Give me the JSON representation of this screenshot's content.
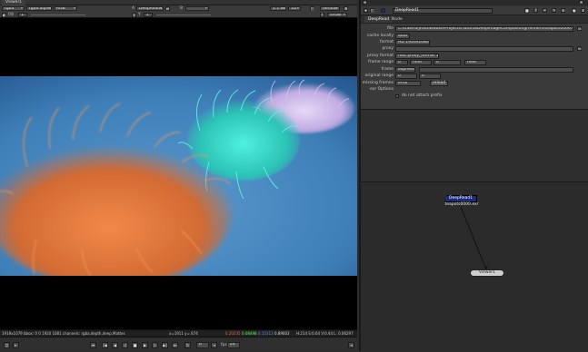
{
  "viewer": {
    "tab_title": "Viewer1",
    "toolbar1": {
      "channels": "rgba",
      "layer": "rgba.alpha",
      "display": "RGB",
      "input_a_label": "A",
      "input_a": "DeepRead1",
      "input_b_label": "B",
      "zoom": "1:1.65",
      "proxy": "1D",
      "lut": "default",
      "colorspace": "sRGB"
    },
    "toolbar2": {
      "fstop_label": "f/8",
      "gain": "1",
      "y_label": "Y",
      "gamma": "1"
    },
    "status": {
      "info": "1919x1079 bbox: 0 0 1920 1081 channels: rgba,depth,deep.Mattes",
      "coords": "x=1911 y= 874",
      "r": "0.20235",
      "g": "0.08498",
      "b": "0.15313",
      "a": "0.89003",
      "hsvl": "H:214 S:0.64 V:0.44  L: 0.06297"
    },
    "timeline": {
      "frame": "0",
      "fps_label": "fps",
      "fps": "24"
    }
  },
  "properties": {
    "node_name": "DeepRead1",
    "tabs": [
      "DeepRead",
      "Node"
    ],
    "knobs": {
      "file_label": "file",
      "file_value": "C:/USERS/JASON/Nuke/Projects/TutorialDeepImageCompositing/renders/teapots0000.exr",
      "cache_locally_label": "cache locally",
      "cache_locally_value": "auto",
      "format_label": "format",
      "format_value": "HD 1920x1080",
      "proxy_label": "proxy",
      "proxy_format_label": "proxy format",
      "proxy_format_value": "root.proxy_format 1024x778",
      "frame_range_label": "frame range",
      "frame_range_start": "0",
      "frame_range_hold1": "hold",
      "frame_range_end": "0",
      "frame_range_hold2": "hold",
      "frame_label": "frame",
      "frame_mode": "expression",
      "original_range_label": "original range",
      "original_range_start": "0",
      "original_range_end": "0",
      "missing_frames_label": "missing frames",
      "missing_frames_value": "error",
      "reload_label": "reload",
      "exr_options_label": "exr Options",
      "do_not_attach_prefix_label": "do not attach prefix"
    }
  },
  "node_graph": {
    "deepread_node": "DeepRead1",
    "deepread_file": "teapots0000.exr",
    "viewer_node": "Viewer1"
  },
  "colors": {
    "deepread_node": "#1e2a7a",
    "viewer_node": "#cfcfcf",
    "background_blue": "#4f8ec4",
    "orange_grass": "#d7743a",
    "cyan_grass": "#37d3c4",
    "lavender_grass": "#c8b4e8"
  }
}
